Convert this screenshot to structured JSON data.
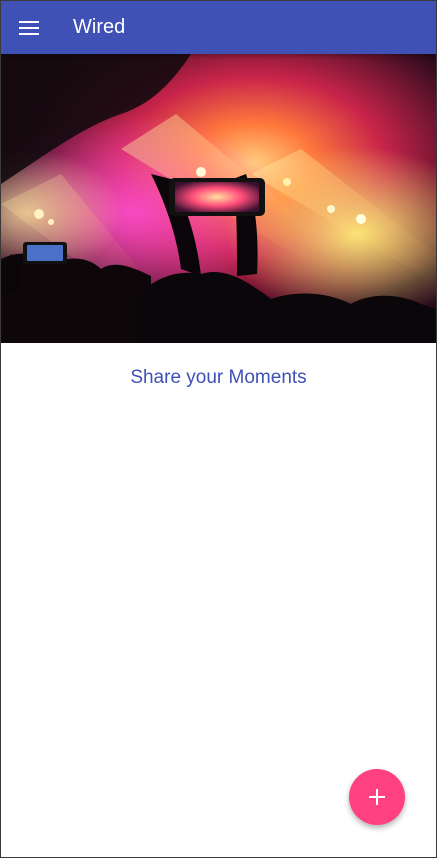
{
  "app": {
    "title": "Wired",
    "brand_color": "#3f51b5",
    "accent_color": "#ff4081"
  },
  "toolbar": {
    "menu_icon": "hamburger-menu-icon"
  },
  "hero": {
    "image_subject": "concert crowd raising phones under stage lights"
  },
  "content": {
    "tagline": "Share your Moments"
  },
  "fab": {
    "icon": "plus-icon"
  }
}
